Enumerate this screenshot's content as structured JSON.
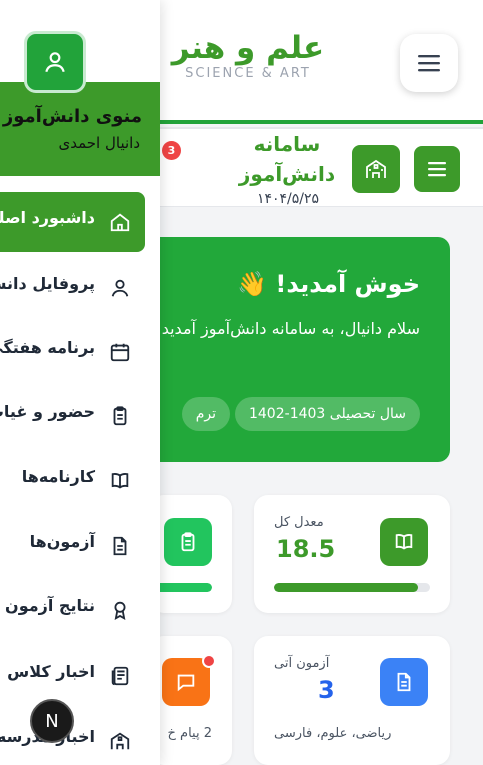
{
  "site": {
    "title": "علم و هنر",
    "subtitle": "SCIENCE & ART"
  },
  "dashboard_header": {
    "title_line1": "سامانه",
    "title_line2": "دانش‌آموز",
    "date": "۱۴۰۴/۵/۲۵",
    "notification_count": "3"
  },
  "welcome": {
    "heading": "خوش آمدید! 👋",
    "message": "سلام دانیال، به سامانه دانش‌آموز آمدید",
    "pill_year": "سال تحصیلی 1403-1402",
    "pill_term": "ترم"
  },
  "cards": {
    "gpa_label": "معدل کل",
    "gpa_value": "18.5",
    "gpa_progress": 0.925,
    "attendance_progress": 1.0,
    "exams_label": "آزمون آتی",
    "exams_value": "3",
    "exams_subjects": "ریاضی، علوم، فارسی",
    "messages_text": "2 پیام خ"
  },
  "drawer": {
    "title": "منوی دانش‌آموز",
    "student_name": "دانیال احمدی",
    "items": [
      {
        "label": "داشبورد اصلی",
        "icon": "home-icon"
      },
      {
        "label": "پروفایل دانش‌آموز",
        "icon": "user-icon"
      },
      {
        "label": "برنامه هفتگی",
        "icon": "calendar-icon"
      },
      {
        "label": "حضور و غیاب",
        "icon": "clipboard-icon"
      },
      {
        "label": "کارنامه‌ها",
        "icon": "book-icon"
      },
      {
        "label": "آزمون‌ها",
        "icon": "document-icon"
      },
      {
        "label": "نتایج آزمون",
        "icon": "award-icon"
      },
      {
        "label": "اخبار کلاس",
        "icon": "news-icon"
      },
      {
        "label": "اخبار مدرسه",
        "icon": "school-icon"
      }
    ]
  },
  "fab_label": "N",
  "colors": {
    "brand_green": "#3d9a2a",
    "bright_green": "#22a83a",
    "blue": "#3b82f6",
    "orange": "#f97316",
    "badge_red": "#ef4444"
  }
}
